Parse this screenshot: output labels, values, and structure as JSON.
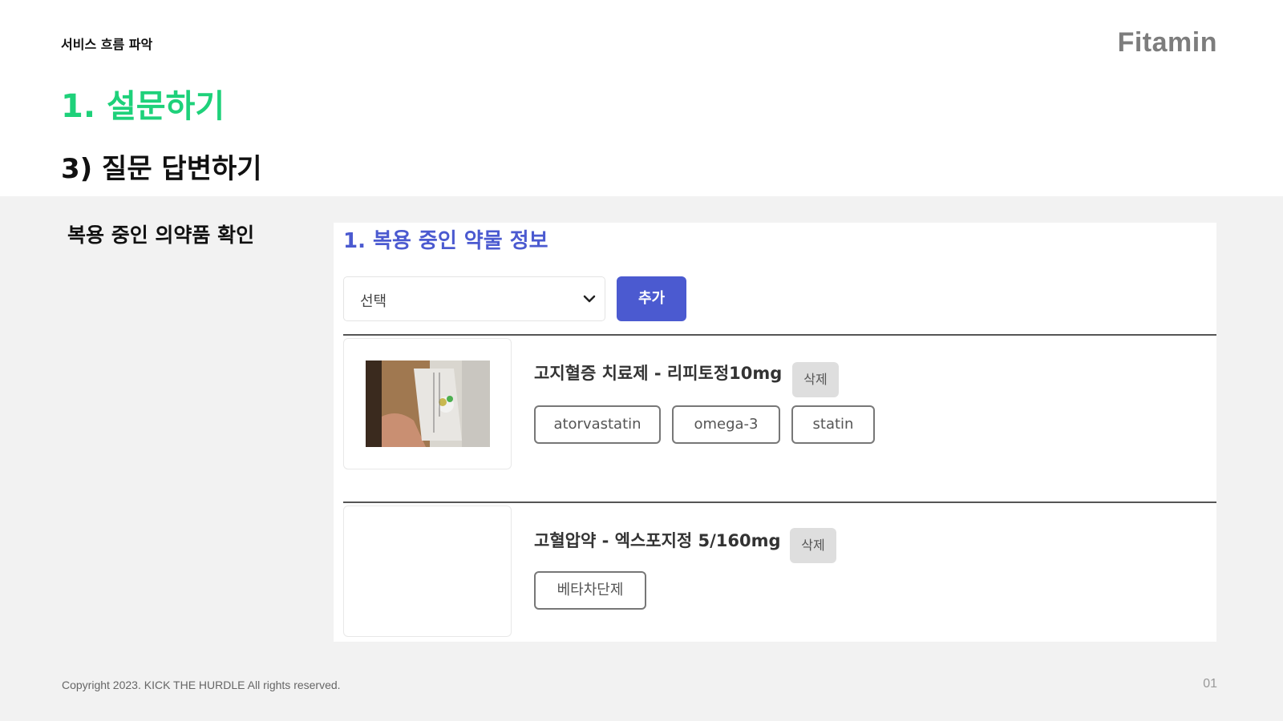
{
  "header": {
    "breadcrumb": "서비스 흐름 파악",
    "logo": "Fitamin",
    "title": "1. 설문하기",
    "subtitle": "3) 질문 답변하기"
  },
  "section": {
    "label": "복용 중인 의약품 확인"
  },
  "panel": {
    "title": "1. 복용 중인 약물 정보",
    "select_value": "선택",
    "add_label": "추가",
    "medications": [
      {
        "name": "고지혈증 치료제 - 리피토정10mg",
        "delete_label": "삭제",
        "has_image": true,
        "tags": [
          "atorvastatin",
          "omega-3",
          "statin"
        ]
      },
      {
        "name": "고혈압약 - 엑스포지정 5/160mg",
        "delete_label": "삭제",
        "has_image": false,
        "tags": [
          "베타차단제"
        ]
      }
    ]
  },
  "footer": {
    "copyright": "Copyright 2023. KICK THE HURDLE All rights reserved.",
    "page_number": "01"
  },
  "colors": {
    "title_green": "#1ed17a",
    "accent_blue": "#4b5ad0",
    "logo_gray": "#7d7d7d"
  },
  "icons": {
    "select_arrow": "chevron-down-icon"
  }
}
